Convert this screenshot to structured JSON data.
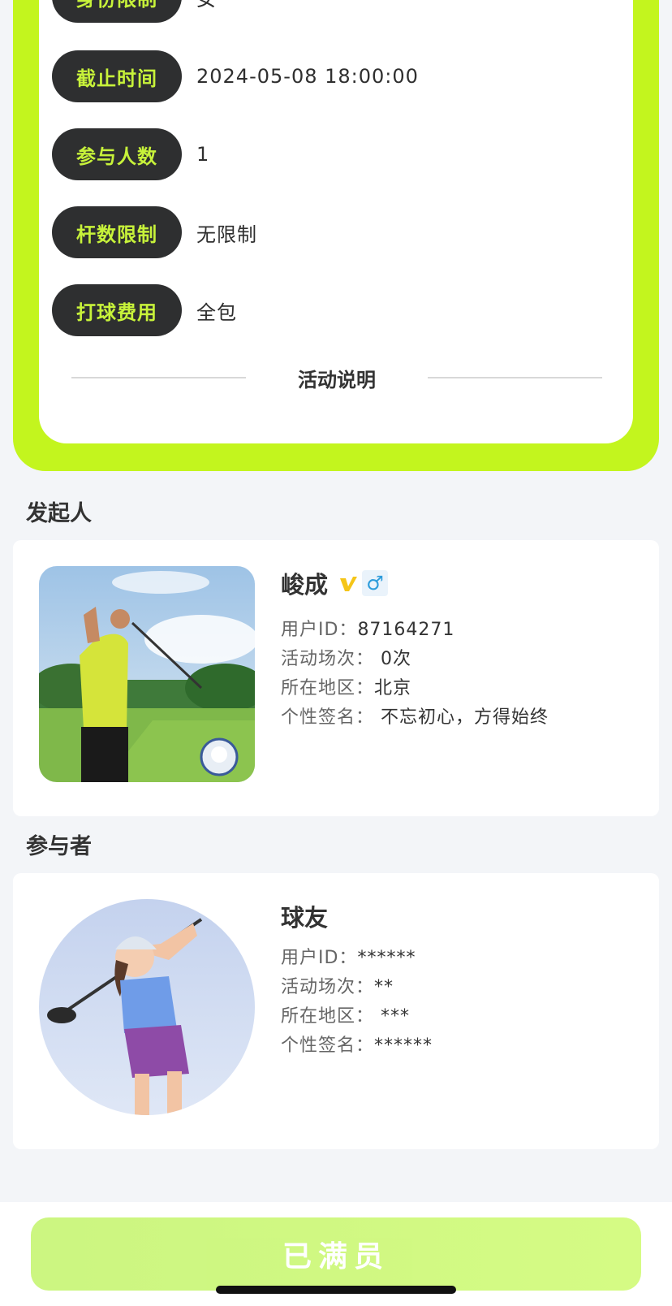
{
  "activity": {
    "rows": [
      {
        "label": "身份限制",
        "value": "女"
      },
      {
        "label": "截止时间",
        "value": "2024-05-08 18:00:00"
      },
      {
        "label": "参与人数",
        "value": "1"
      },
      {
        "label": "杆数限制",
        "value": "无限制"
      },
      {
        "label": "打球费用",
        "value": "全包"
      }
    ],
    "description_title": "活动说明"
  },
  "organizer": {
    "section_title": "发起人",
    "name": "峻成",
    "gender_symbol": "♂",
    "user_id_label": "用户ID：",
    "user_id": "87164271",
    "sessions_label": "活动场次：",
    "sessions": "0次",
    "region_label": "所在地区：",
    "region": "北京",
    "signature_label": "个性签名：",
    "signature": "不忘初心，方得始终"
  },
  "participant": {
    "section_title": "参与者",
    "name": "球友",
    "user_id_label": "用户ID：",
    "user_id": "******",
    "sessions_label": "活动场次：",
    "sessions": "**",
    "region_label": "所在地区：",
    "region": "***",
    "signature_label": "个性签名：",
    "signature": "******"
  },
  "bottom": {
    "button_label": "已满员"
  },
  "colors": {
    "accent": "#c3f51e",
    "pill_bg": "#2e2f30",
    "pill_text": "#c7f23a"
  }
}
